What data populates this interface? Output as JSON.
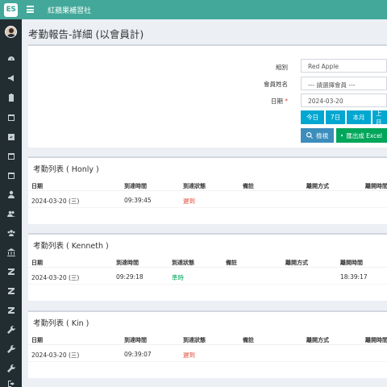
{
  "app": {
    "title": "紅蘋果補習社",
    "logo_text": "ES"
  },
  "page": {
    "title": "考勤報告-詳細 (以會員計)"
  },
  "sidebar": {
    "icons": [
      "dashboard-icon",
      "megaphone-icon",
      "clipboard-icon",
      "calendar-icon",
      "calendar-check-icon",
      "calendar-icon",
      "calendar-icon",
      "user-icon",
      "users-icon",
      "group-icon",
      "bank-icon",
      "z-icon",
      "z-icon",
      "z-icon",
      "wrench-icon",
      "wrench-icon",
      "wrench-icon",
      "sign-out-icon"
    ]
  },
  "filter": {
    "group_label": "組別",
    "group_value": "Red Apple",
    "member_label": "會員姓名",
    "member_placeholder": "--- 請選擇會員 ---",
    "date_label": "日期",
    "required_mark": "*",
    "date_value": "2024-03-20",
    "date_buttons": [
      "今日",
      "7日",
      "本月",
      "上月"
    ],
    "search_label": "檢視",
    "export_label": "匯出成 Excel"
  },
  "columns": {
    "date": "日期",
    "arrival_time": "到達時間",
    "arrival_status": "到達狀態",
    "remark": "備註",
    "leave_method": "離開方式",
    "leave_time": "離開時間"
  },
  "records": [
    {
      "title": "考勤列表 ( Honly )",
      "date": "2024-03-20 (三)",
      "arrival_time": "09:39:45",
      "status": "遲到",
      "status_color": "#dd4b39",
      "remark": "",
      "leave_method": "",
      "leave_time": ""
    },
    {
      "title": "考勤列表 ( Kenneth )",
      "date": "2024-03-20 (三)",
      "arrival_time": "09:29:18",
      "status": "準時",
      "status_color": "#00a65a",
      "remark": "",
      "leave_method": "",
      "leave_time": "18:39:17"
    },
    {
      "title": "考勤列表 ( Kin )",
      "date": "2024-03-20 (三)",
      "arrival_time": "09:39:07",
      "status": "遲到",
      "status_color": "#dd4b39",
      "remark": "",
      "leave_method": "",
      "leave_time": ""
    }
  ],
  "colors": {
    "brand": "#43a89a",
    "sidebar": "#222d32",
    "info": "#00a7d0",
    "primary": "#3c8dbc",
    "success": "#00a65a",
    "danger": "#dd4b39"
  }
}
